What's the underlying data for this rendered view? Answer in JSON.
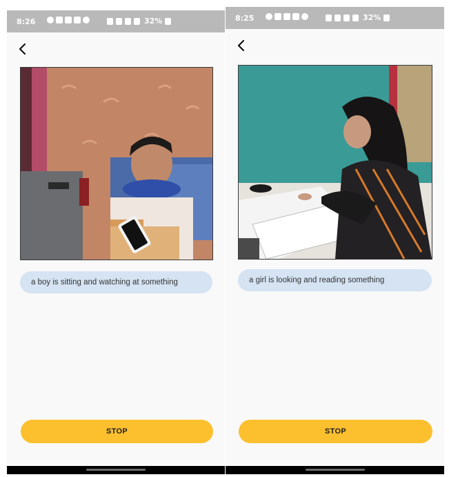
{
  "left": {
    "status": {
      "time": "8:26",
      "battery": "32%"
    },
    "back_icon": "back-arrow-icon",
    "caption": "a boy is sitting and watching at something",
    "stop_label": "STOP"
  },
  "right": {
    "status": {
      "time": "8:25",
      "battery": "32%"
    },
    "back_icon": "back-arrow-icon",
    "caption": "a girl is looking and reading something",
    "stop_label": "STOP"
  },
  "colors": {
    "status_bar": "#b9b9b9",
    "caption_bg": "#d5e3f3",
    "stop_button": "#fcc02f",
    "screen_bg": "#f9f9f9"
  }
}
